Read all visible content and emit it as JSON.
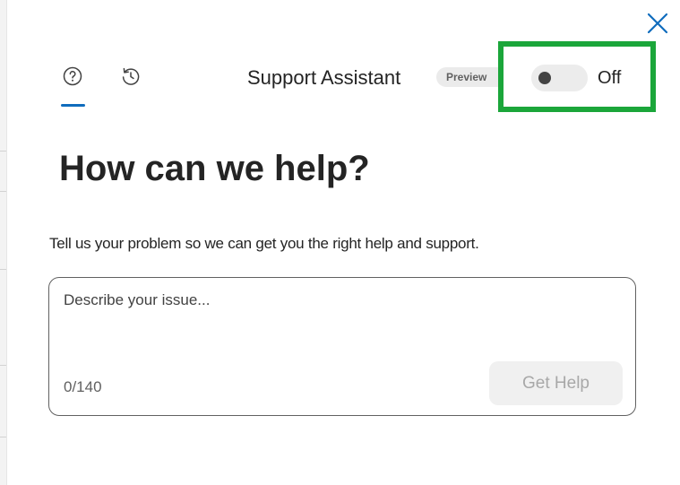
{
  "header": {
    "title": "Support Assistant",
    "badge": "Preview",
    "toggle": {
      "state": "off",
      "label": "Off"
    }
  },
  "tabs": [
    {
      "icon": "help-circle-icon",
      "active": true
    },
    {
      "icon": "history-icon",
      "active": false
    }
  ],
  "main": {
    "heading": "How can we help?",
    "subtext": "Tell us your problem so we can get you the right help and support.",
    "input": {
      "placeholder": "Describe your issue...",
      "value": ""
    },
    "char_count": "0/140",
    "submit_label": "Get Help"
  },
  "colors": {
    "accent": "#0f6cbd",
    "highlight": "#1ba63a",
    "disabled_button_bg": "#f0f0f0",
    "disabled_button_text": "#a8a8a8"
  }
}
